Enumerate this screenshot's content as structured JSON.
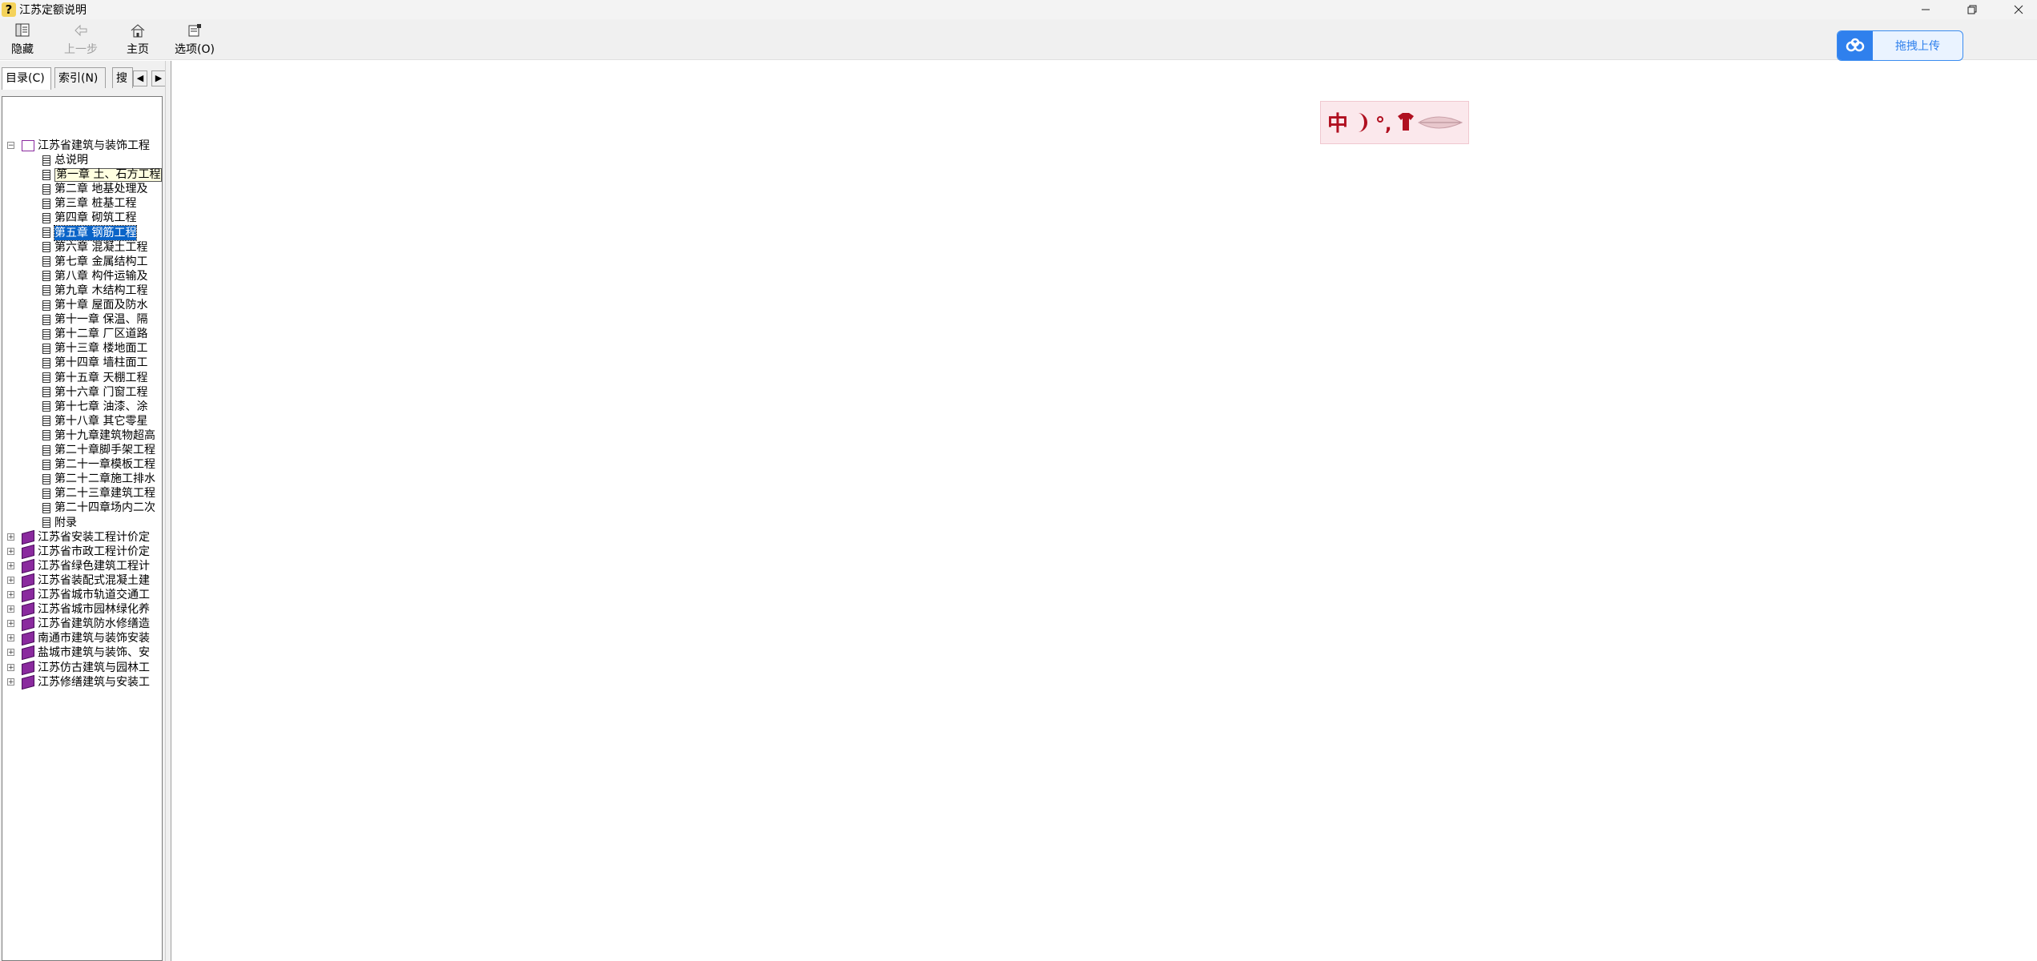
{
  "window": {
    "title": "江苏定额说明",
    "icon": "help-icon"
  },
  "toolbar": {
    "hide_label": "隐藏",
    "back_label": "上一步",
    "home_label": "主页",
    "options_label": "选项(O)"
  },
  "upload": {
    "label": "拖拽上传",
    "icon": "cloud-icon"
  },
  "tabs": {
    "contents": "目录(C)",
    "index": "索引(N)",
    "search": "搜"
  },
  "tree": {
    "root": "江苏省建筑与装饰工程",
    "chapters": [
      "总说明",
      "第一章  土、石方工程",
      "第二章  地基处理及",
      "第三章  桩基工程",
      "第四章  砌筑工程",
      "第五章  钢筋工程",
      "第六章  混凝土工程",
      "第七章  金属结构工",
      "第八章  构件运输及",
      "第九章  木结构工程",
      "第十章  屋面及防水",
      "第十一章  保温、隔",
      "第十二章  厂区道路",
      "第十三章  楼地面工",
      "第十四章  墙柱面工",
      "第十五章  天棚工程",
      "第十六章  门窗工程",
      "第十七章  油漆、涂",
      "第十八章  其它零星",
      "第十九章建筑物超高",
      "第二十章脚手架工程",
      "第二十一章模板工程",
      "第二十二章施工排水",
      "第二十三章建筑工程",
      "第二十四章场内二次",
      "附录"
    ],
    "books": [
      "江苏省安装工程计价定",
      "江苏省市政工程计价定",
      "江苏省绿色建筑工程计",
      "江苏省装配式混凝土建",
      "江苏省城市轨道交通工",
      "江苏省城市园林绿化养",
      "江苏省建筑防水修缮造",
      "南通市建筑与装饰安装",
      "盐城市建筑与装饰、安",
      "江苏仿古建筑与园林工",
      "江苏修缮建筑与安装工"
    ],
    "hover_index": 1,
    "selected_index": 5
  },
  "colors": {
    "selected_bg": "#0a64c8",
    "hover_bg": "#ffffe1",
    "book_closed": "#8a2a9e",
    "upload_accent": "#2f80ed",
    "banner_bg": "#fbe8ec"
  }
}
